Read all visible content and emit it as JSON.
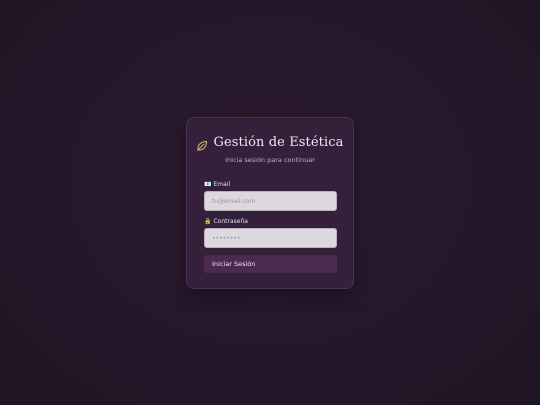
{
  "login": {
    "title": "Gestión de Estética",
    "subtitle": "Inicia sesión para continuar",
    "email": {
      "icon": "envelope-icon",
      "icon_glyph": "📧",
      "label": "Email",
      "placeholder": "tu@email.com",
      "value": ""
    },
    "password": {
      "icon": "lock-icon",
      "icon_glyph": "🔒",
      "label": "Contraseña",
      "placeholder": "••••••••",
      "value": ""
    },
    "submit_label": "Iniciar Sesión",
    "logo_icon": "leaf-icon"
  },
  "colors": {
    "background": "#25172a",
    "card": "#34203a",
    "accent_gold": "#d9b777",
    "button": "#4d2a4f",
    "input": "#dcd8de"
  }
}
